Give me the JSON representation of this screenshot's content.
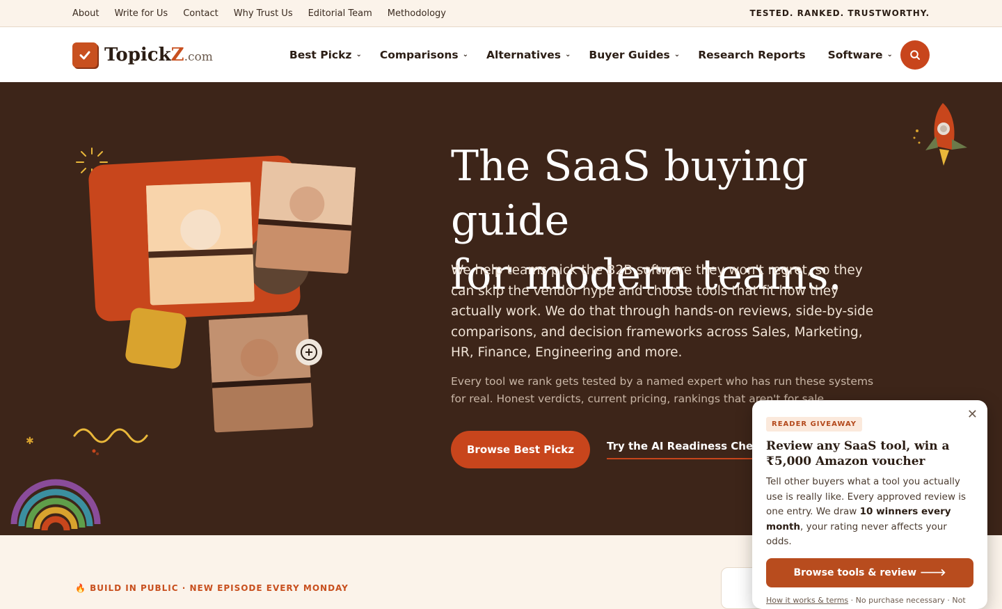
{
  "utility": {
    "links": [
      "About",
      "Write for Us",
      "Contact",
      "Why Trust Us",
      "Editorial Team",
      "Methodology"
    ],
    "tagline": "TESTED. RANKED. TRUSTWORTHY."
  },
  "brand": {
    "name_a": "Topick",
    "name_b": "Z",
    "tld": ".com"
  },
  "nav": {
    "items": [
      {
        "label": "Best Pickz",
        "dropdown": "⌄"
      },
      {
        "label": "Comparisons",
        "dropdown": "⌄"
      },
      {
        "label": "Alternatives",
        "dropdown": "⌄"
      },
      {
        "label": "Buyer Guides",
        "dropdown": "⌄"
      },
      {
        "label": "Research Reports",
        "dropdown": ""
      },
      {
        "label": "Software",
        "dropdown": "⌄"
      }
    ],
    "search_icon": "search-icon"
  },
  "hero": {
    "title_line1": "The SaaS buying guide",
    "title_line2": "for modern teams.",
    "lead": "We help teams pick the B2B software they won't regret, so they can skip the vendor hype and choose tools that fit how they actually work. We do that through hands-on reviews, side-by-side comparisons, and decision frameworks across Sales, Marketing, HR, Finance, Engineering and more.",
    "sub": "Every tool we rank gets tested by a named expert who has run these systems for real. Honest verdicts, current pricing, rankings that aren't for sale.",
    "primary_cta": "Browse Best Pickz",
    "secondary_cta": "Try the AI Readiness Checker"
  },
  "lower": {
    "kicker": "🔥 BUILD IN PUBLIC · NEW EPISODE EVERY MONDAY"
  },
  "popup": {
    "badge": "READER GIVEAWAY",
    "title": "Review any SaaS tool, win a ₹5,000 Amazon voucher",
    "body_a": "Tell other buyers what a tool you actually use is really like. Every approved review is one entry. We draw ",
    "body_bold": "10 winners every month",
    "body_b": ", your rating never affects your odds.",
    "cta": "Browse tools & review 🡒",
    "fine_link": "How it works & terms",
    "fine_text": " · No purchase necessary · Not"
  },
  "colors": {
    "accent": "#c8451c",
    "hero_bg": "#3d2519",
    "cream": "#fbf3ea"
  }
}
